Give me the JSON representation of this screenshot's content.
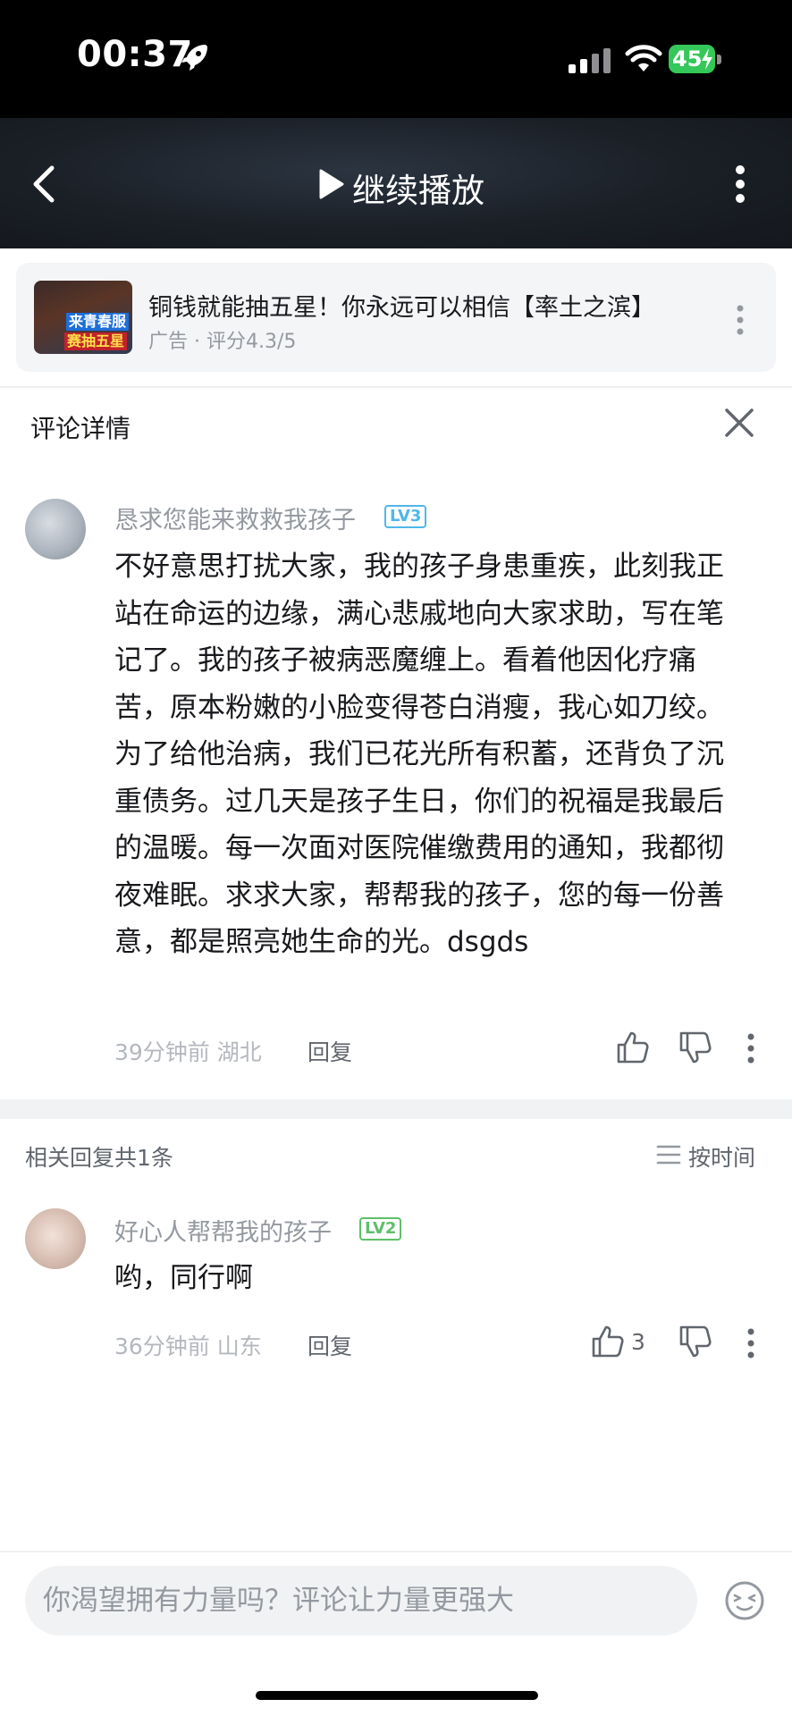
{
  "status_bar": {
    "time": "00:37",
    "battery": "45",
    "icons": [
      "rocket-icon",
      "signal-icon",
      "wifi-icon",
      "battery-charging-icon"
    ]
  },
  "header": {
    "continue_label": "继续播放",
    "icons": [
      "back-chevron-icon",
      "play-icon",
      "more-vertical-icon"
    ]
  },
  "ad": {
    "thumb_text_1": "来青春服",
    "thumb_text_2": "赛抽五星",
    "title": "铜钱就能抽五星！你永远可以相信【率土之滨】",
    "subtitle": "广告 · 评分4.3/5"
  },
  "comment_detail": {
    "title": "评论详情"
  },
  "main_comment": {
    "username": "恳求您能来救救我孩子",
    "level": "LV3",
    "text": "不好意思打扰大家，我的孩子身患重疾，此刻我正站在命运的边缘，满心悲戚地向大家求助，写在笔记了。我的孩子被病恶魔缠上。看着他因化疗痛苦，原本粉嫩的小脸变得苍白消瘦，我心如刀绞。为了给他治病，我们已花光所有积蓄，还背负了沉重债务。过几天是孩子生日，你们的祝福是我最后的温暖。每一次面对医院催缴费用的通知，我都彻夜难眠。求求大家，帮帮我的孩子，您的每一份善意，都是照亮她生命的光。dsgds",
    "time": "39分钟前",
    "location": "湖北",
    "reply_label": "回复"
  },
  "replies": {
    "count_label": "相关回复共1条",
    "sort_label": "按时间",
    "items": [
      {
        "username": "好心人帮帮我的孩子",
        "level": "LV2",
        "text": "哟，同行啊",
        "time": "36分钟前",
        "location": "山东",
        "reply_label": "回复",
        "likes": "3"
      }
    ]
  },
  "bottom": {
    "input_placeholder": "你渴望拥有力量吗？评论让力量更强大"
  },
  "colors": {
    "lv3": "#4fb7ea",
    "lv2": "#5ec06a",
    "battery": "#34c759"
  }
}
